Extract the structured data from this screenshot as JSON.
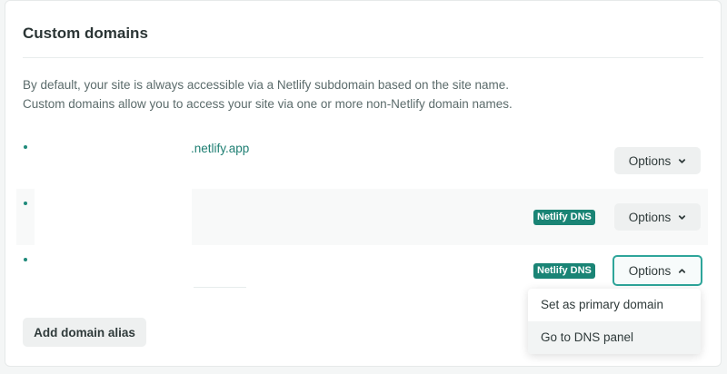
{
  "section": {
    "title": "Custom domains",
    "description_line1": "By default, your site is always accessible via a Netlify subdomain based on the site name.",
    "description_line2": "Custom domains allow you to access your site via one or more non-Netlify domain names."
  },
  "domains": [
    {
      "name": ".netlify.app",
      "badge": "",
      "options_label": "Options",
      "options_open": false
    },
    {
      "name": "",
      "badge": "Netlify DNS",
      "options_label": "Options",
      "options_open": false
    },
    {
      "name": "",
      "badge": "Netlify DNS",
      "options_label": "Options",
      "options_open": true
    }
  ],
  "dropdown": {
    "items": [
      "Set as primary domain",
      "Go to DNS panel"
    ]
  },
  "add_domain_alias_label": "Add domain alias",
  "colors": {
    "accent": "#1a8475",
    "link": "#1f7f73",
    "button_bg": "#eef0f0"
  }
}
